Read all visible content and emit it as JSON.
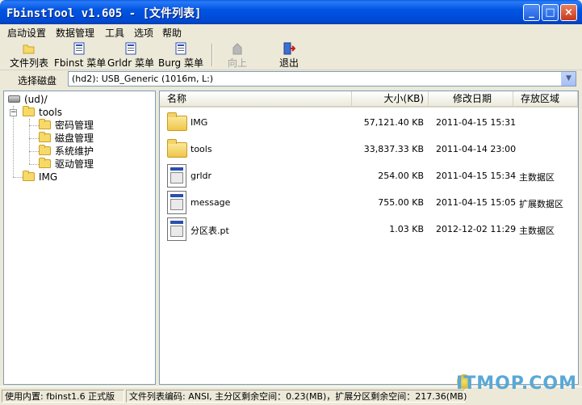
{
  "window": {
    "title": "FbinstTool v1.605 - [文件列表]",
    "minimize": "_",
    "maximize": "□",
    "close": "×"
  },
  "menubar": {
    "items": [
      "启动设置",
      "数据管理",
      "工具",
      "选项",
      "帮助"
    ]
  },
  "toolbar": {
    "file_list": "文件列表",
    "fbinst_menu": "Fbinst 菜单",
    "grldr_menu": "Grldr 菜单",
    "burg_menu": "Burg 菜单",
    "up": "向上",
    "exit": "退出"
  },
  "disk": {
    "label": "选择磁盘",
    "selected": "(hd2): USB_Generic  (1016m, L:)"
  },
  "tree": {
    "root": "(ud)/",
    "tools": "tools",
    "children": [
      "密码管理",
      "磁盘管理",
      "系统维护",
      "驱动管理"
    ],
    "img": "IMG"
  },
  "list": {
    "columns": {
      "name": "名称",
      "size": "大小(KB)",
      "date": "修改日期",
      "area": "存放区域"
    },
    "rows": [
      {
        "name": "IMG",
        "size": "57,121.40 KB",
        "date": "2011-04-15 15:31",
        "area": ""
      },
      {
        "name": "tools",
        "size": "33,837.33 KB",
        "date": "2011-04-14 23:00",
        "area": ""
      },
      {
        "name": "grldr",
        "size": "254.00 KB",
        "date": "2011-04-15 15:34",
        "area": "主数据区"
      },
      {
        "name": "message",
        "size": "755.00 KB",
        "date": "2011-04-15 15:05",
        "area": "扩展数据区"
      },
      {
        "name": "分区表.pt",
        "size": "1.03 KB",
        "date": "2012-12-02 11:29",
        "area": "主数据区"
      }
    ]
  },
  "status": {
    "version": "使用内置: fbinst1.6 正式版",
    "info": "文件列表编码: ANSI, 主分区剩余空间：0.23(MB)，扩展分区剩余空间：217.36(MB)"
  },
  "watermark": "ITMOP.COM",
  "colors": {
    "titlebar": "#0054e3",
    "face": "#ece9d8",
    "folder": "#f7d968"
  }
}
